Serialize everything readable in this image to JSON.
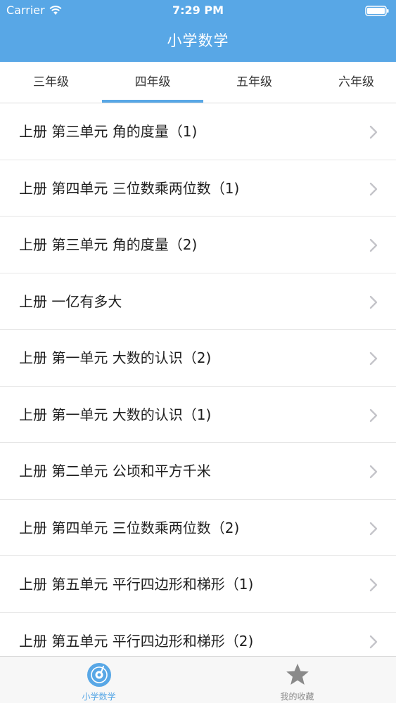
{
  "status_bar": {
    "carrier": "Carrier",
    "time": "7:29 PM"
  },
  "nav": {
    "title": "小学数学"
  },
  "tabs": [
    {
      "label": "三年级",
      "active": false
    },
    {
      "label": "四年级",
      "active": true
    },
    {
      "label": "五年级",
      "active": false
    },
    {
      "label": "六年级",
      "active": false
    }
  ],
  "list": {
    "items": [
      {
        "label": "上册 第三单元 角的度量（1)"
      },
      {
        "label": "上册 第四单元 三位数乘两位数（1)"
      },
      {
        "label": "上册 第三单元 角的度量（2)"
      },
      {
        "label": "上册 一亿有多大"
      },
      {
        "label": "上册 第一单元 大数的认识（2)"
      },
      {
        "label": "上册 第一单元 大数的认识（1)"
      },
      {
        "label": "上册 第二单元 公顷和平方千米"
      },
      {
        "label": "上册 第四单元 三位数乘两位数（2)"
      },
      {
        "label": "上册 第五单元 平行四边形和梯形（1)"
      },
      {
        "label": "上册 第五单元 平行四边形和梯形（2)"
      }
    ]
  },
  "tabbar": {
    "items": [
      {
        "label": "小学数学",
        "icon": "disc-icon",
        "active": true
      },
      {
        "label": "我的收藏",
        "icon": "star-icon",
        "active": false
      }
    ]
  },
  "colors": {
    "accent": "#58a7e6",
    "tabbar_inactive": "#8a8a8a",
    "text": "#1e1e1e"
  }
}
